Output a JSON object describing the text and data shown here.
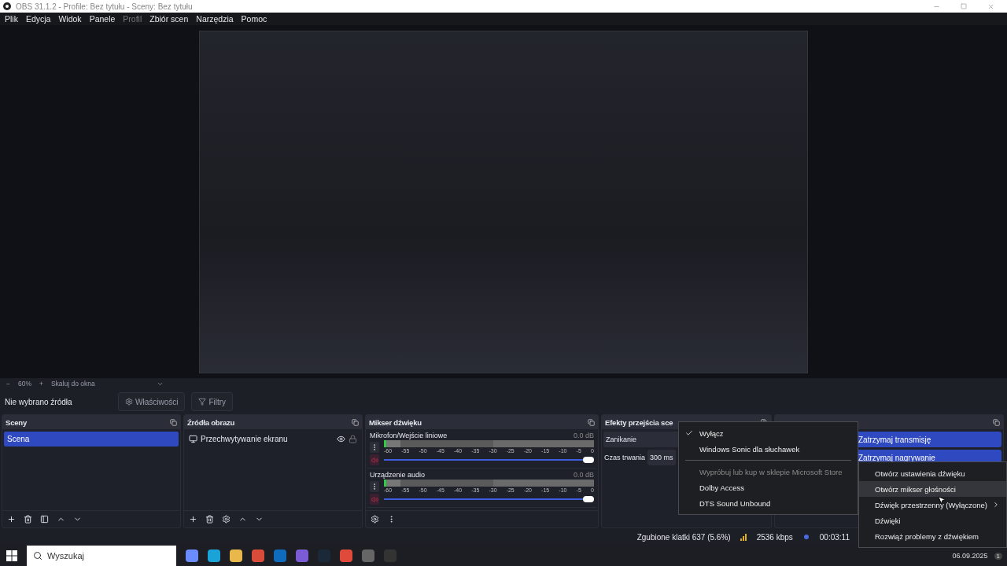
{
  "window": {
    "title": "OBS 31.1.2 - Profile: Bez tytułu - Sceny: Bez tytułu"
  },
  "menu": [
    {
      "label": "Plik",
      "disabled": false
    },
    {
      "label": "Edycja",
      "disabled": false
    },
    {
      "label": "Widok",
      "disabled": false
    },
    {
      "label": "Panele",
      "disabled": false
    },
    {
      "label": "Profil",
      "disabled": true
    },
    {
      "label": "Zbiór scen",
      "disabled": false
    },
    {
      "label": "Narzędzia",
      "disabled": false
    },
    {
      "label": "Pomoc",
      "disabled": false
    }
  ],
  "zoom_bar": {
    "minus": "−",
    "zoom": "60%",
    "plus": "+",
    "scale_mode": "Skaluj do okna"
  },
  "source_toolbar": {
    "label": "Nie wybrano źródła",
    "buttons": [
      "Właściwości",
      "Filtry"
    ]
  },
  "scenes": {
    "title": "Sceny",
    "items": [
      {
        "label": "Scena",
        "selected": true
      }
    ]
  },
  "sources": {
    "title": "Źródła obrazu",
    "items": [
      {
        "label": "Przechwytywanie ekranu"
      }
    ]
  },
  "mixer": {
    "title": "Mikser dźwięku",
    "channels": [
      {
        "name": "Mikrofon/Wejście liniowe",
        "reading": "0.0 dB",
        "level": 1.0,
        "muted": true,
        "scale": [
          "-60",
          "-55",
          "-50",
          "-45",
          "-40",
          "-35",
          "-30",
          "-25",
          "-20",
          "-15",
          "-10",
          "-5",
          "0"
        ]
      },
      {
        "name": "Urządzenie audio",
        "reading": "0.0 dB",
        "level": 1.0,
        "muted": true,
        "scale": [
          "-60",
          "-55",
          "-50",
          "-45",
          "-40",
          "-35",
          "-30",
          "-25",
          "-20",
          "-15",
          "-10",
          "-5",
          "0"
        ]
      }
    ]
  },
  "transitions": {
    "title": "Efekty przejścia sce",
    "transition": "Zanikanie",
    "duration_label": "Czas trwania",
    "duration": "300 ms"
  },
  "controls": {
    "buttons": [
      "Zatrzymaj transmisję",
      "Zatrzymaj nagrywanie"
    ]
  },
  "status_bar": {
    "dropped_frames": "Zgubione klatki 637 (5.6%)",
    "bitrate": "2536 kbps",
    "time": "00:03:11"
  },
  "spatial_menu": {
    "items": [
      {
        "kind": "item",
        "label": "Wyłącz",
        "checked": true,
        "disabled": false
      },
      {
        "kind": "item",
        "label": "Windows Sonic dla słuchawek",
        "checked": false,
        "disabled": false
      },
      {
        "kind": "separator"
      },
      {
        "kind": "item",
        "label": "Wypróbuj lub kup w sklepie Microsoft Store",
        "checked": false,
        "disabled": true
      },
      {
        "kind": "item",
        "label": "Dolby Access",
        "checked": false,
        "disabled": false
      },
      {
        "kind": "item",
        "label": "DTS Sound Unbound",
        "checked": false,
        "disabled": false
      }
    ]
  },
  "tray_menu": {
    "items": [
      {
        "label": "Otwórz ustawienia dźwięku",
        "selected": false,
        "submenu": false
      },
      {
        "label": "Otwórz mikser głośności",
        "selected": true,
        "submenu": false
      },
      {
        "label": "Dźwięk przestrzenny (Wyłączone)",
        "selected": false,
        "submenu": true
      },
      {
        "label": "Dźwięki",
        "selected": false,
        "submenu": false
      },
      {
        "label": "Rozwiąż problemy z dźwiękiem",
        "selected": false,
        "submenu": false
      }
    ]
  },
  "taskbar": {
    "search_placeholder": "Wyszukaj",
    "date": "06.09.2025",
    "notifications": "1"
  }
}
